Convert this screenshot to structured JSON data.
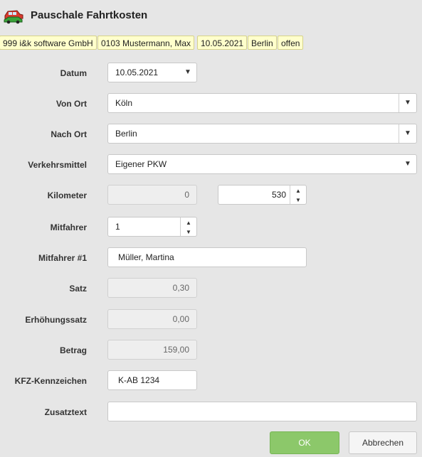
{
  "window": {
    "title": "Pauschale Fahrtkosten",
    "icon": "car-icon"
  },
  "chips": [
    "999 i&k software GmbH",
    "0103 Mustermann, Max",
    "10.05.2021",
    "Berlin",
    "offen"
  ],
  "form": {
    "datum": {
      "label": "Datum",
      "value": "10.05.2021"
    },
    "von_ort": {
      "label": "Von Ort",
      "value": "Köln"
    },
    "nach_ort": {
      "label": "Nach Ort",
      "value": "Berlin"
    },
    "verkehrsmittel": {
      "label": "Verkehrsmittel",
      "value": "Eigener PKW"
    },
    "kilometer": {
      "label": "Kilometer",
      "value": "0",
      "value2": "530"
    },
    "mitfahrer": {
      "label": "Mitfahrer",
      "value": "1"
    },
    "mitfahrer1": {
      "label": "Mitfahrer #1",
      "value": "Müller, Martina"
    },
    "satz": {
      "label": "Satz",
      "value": "0,30"
    },
    "erhoehungssatz": {
      "label": "Erhöhungssatz",
      "value": "0,00"
    },
    "betrag": {
      "label": "Betrag",
      "value": "159,00"
    },
    "kfz": {
      "label": "KFZ-Kennzeichen",
      "value": "K-AB 1234"
    },
    "zusatztext": {
      "label": "Zusatztext",
      "value": ""
    }
  },
  "buttons": {
    "ok": "OK",
    "cancel": "Abbrechen"
  }
}
